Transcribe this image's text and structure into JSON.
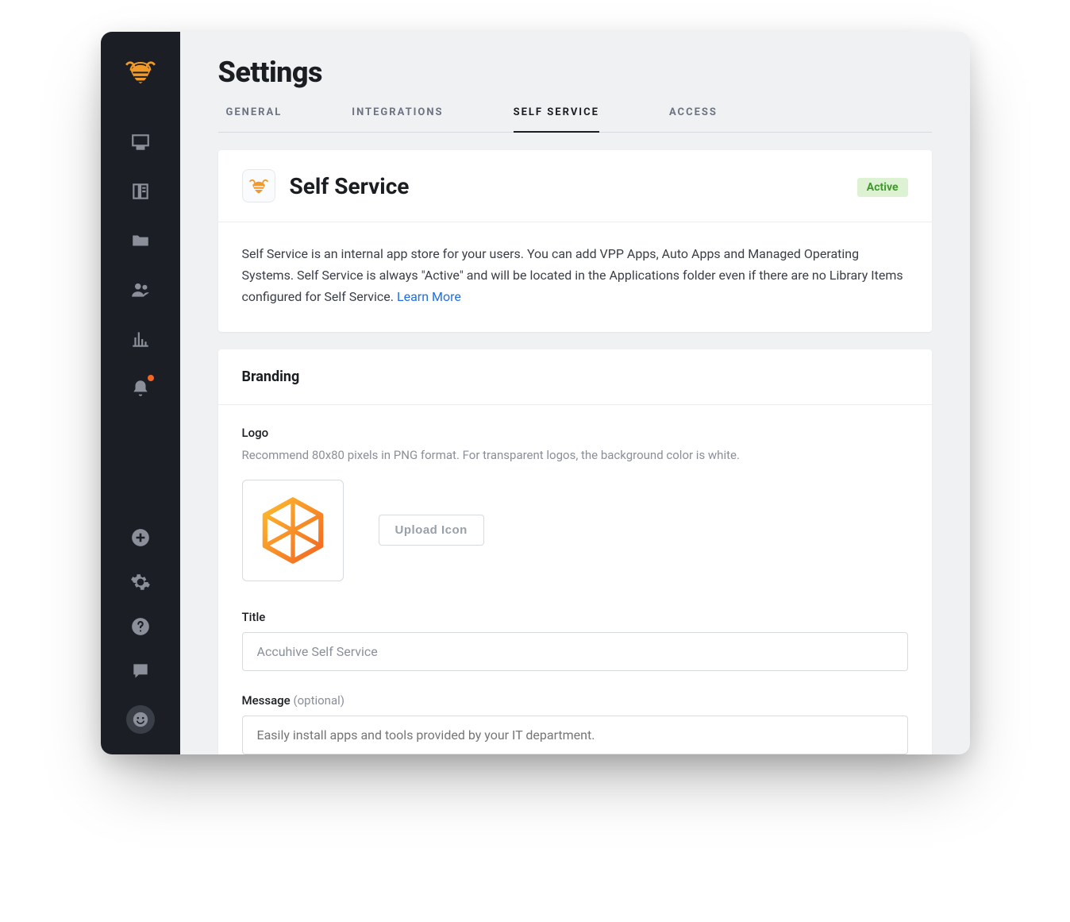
{
  "brand": {
    "color": "#f19a2a"
  },
  "page": {
    "title": "Settings"
  },
  "tabs": [
    {
      "label": "General",
      "active": false
    },
    {
      "label": "Integrations",
      "active": false
    },
    {
      "label": "Self Service",
      "active": true
    },
    {
      "label": "Access",
      "active": false
    }
  ],
  "self_service": {
    "title": "Self Service",
    "status": "Active",
    "description_pre": "Self Service is an internal app store for your users. You can add VPP Apps, Auto Apps and Managed Operating Systems. Self Service is always \"Active\" and will be located in the Applications folder even if there are no Library Items configured for Self Service. ",
    "learn_more": "Learn More"
  },
  "branding": {
    "section_title": "Branding",
    "logo_label": "Logo",
    "logo_help": "Recommend 80x80 pixels in PNG format. For transparent logos, the background color is white.",
    "upload_button": "Upload Icon",
    "title_label": "Title",
    "title_value": "Accuhive Self Service",
    "message_label": "Message ",
    "message_hint": "(optional)",
    "message_placeholder": "Easily install apps and tools provided by your IT department."
  }
}
